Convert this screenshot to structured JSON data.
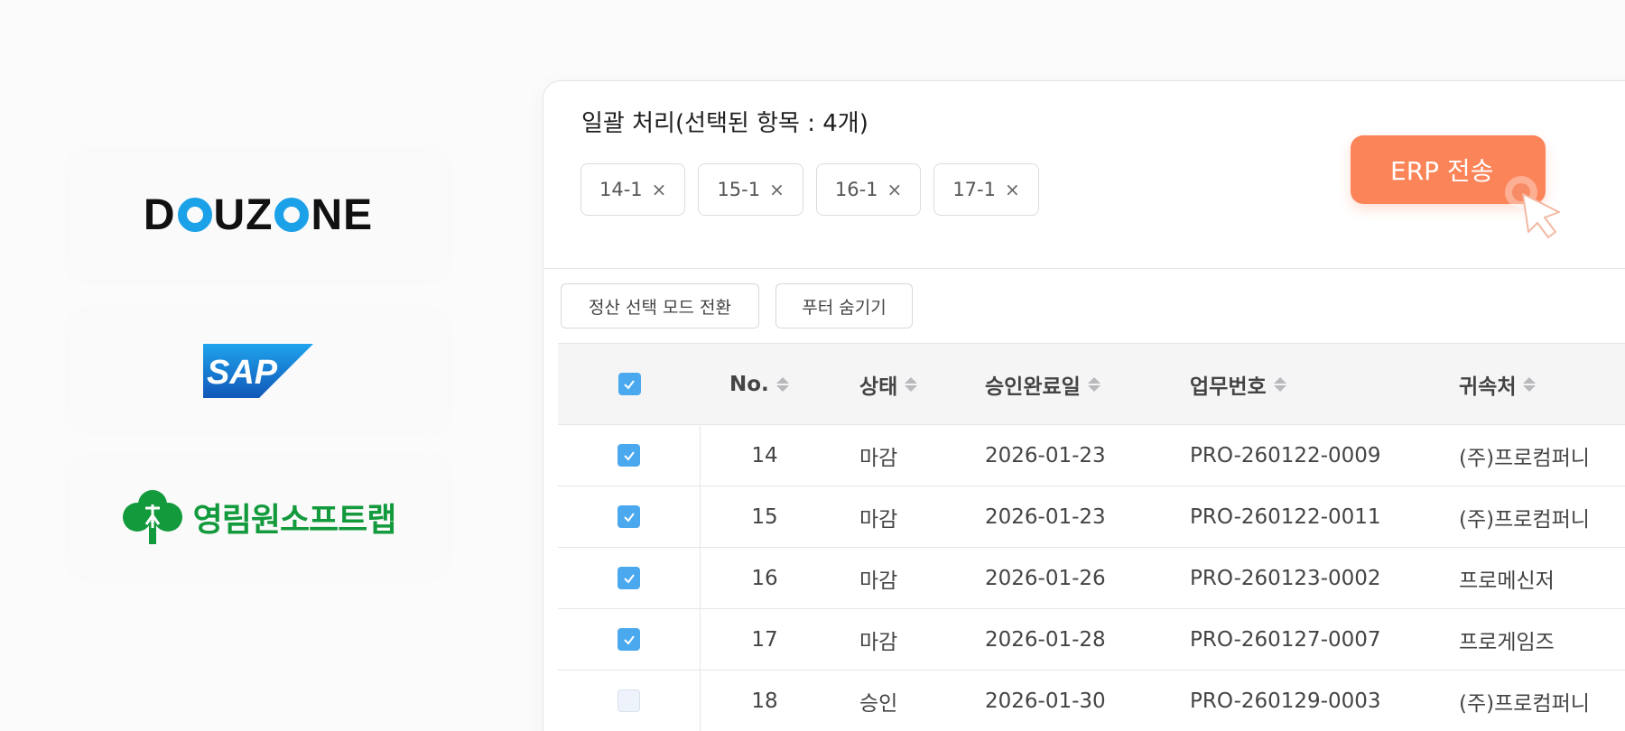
{
  "logos": {
    "douzone": "DOUZONE",
    "sap": "SAP",
    "younglim": "영림원소프트랩"
  },
  "panel": {
    "batch_title": "일괄 처리(선택된 항목 : 4개)",
    "chips": [
      "14-1",
      "15-1",
      "16-1",
      "17-1"
    ],
    "chip_close": "×",
    "erp_button": "ERP 전송",
    "toolbar": {
      "mode_toggle": "정산 선택 모드 전환",
      "hide_footer": "푸터 숨기기"
    }
  },
  "table": {
    "headers": {
      "no": "No.",
      "status": "상태",
      "approved_date": "승인완료일",
      "task_no": "업무번호",
      "owner": "귀속처"
    },
    "rows": [
      {
        "no": "14",
        "status": "마감",
        "date": "2026-01-23",
        "task": "PRO-260122-0009",
        "owner": "(주)프로컴퍼니",
        "checked": true
      },
      {
        "no": "15",
        "status": "마감",
        "date": "2026-01-23",
        "task": "PRO-260122-0011",
        "owner": "(주)프로컴퍼니",
        "checked": true
      },
      {
        "no": "16",
        "status": "마감",
        "date": "2026-01-26",
        "task": "PRO-260123-0002",
        "owner": "프로메신저",
        "checked": true
      },
      {
        "no": "17",
        "status": "마감",
        "date": "2026-01-28",
        "task": "PRO-260127-0007",
        "owner": "프로게임즈",
        "checked": true
      },
      {
        "no": "18",
        "status": "승인",
        "date": "2026-01-30",
        "task": "PRO-260129-0003",
        "owner": "(주)프로컴퍼니",
        "checked": false
      }
    ]
  },
  "colors": {
    "accent_orange": "#fb8459",
    "checkbox_blue": "#4aa8ee",
    "douzone_blue": "#1aa1e8",
    "sap_blue": "#1c6fd1",
    "younglim_green": "#129a3c"
  }
}
